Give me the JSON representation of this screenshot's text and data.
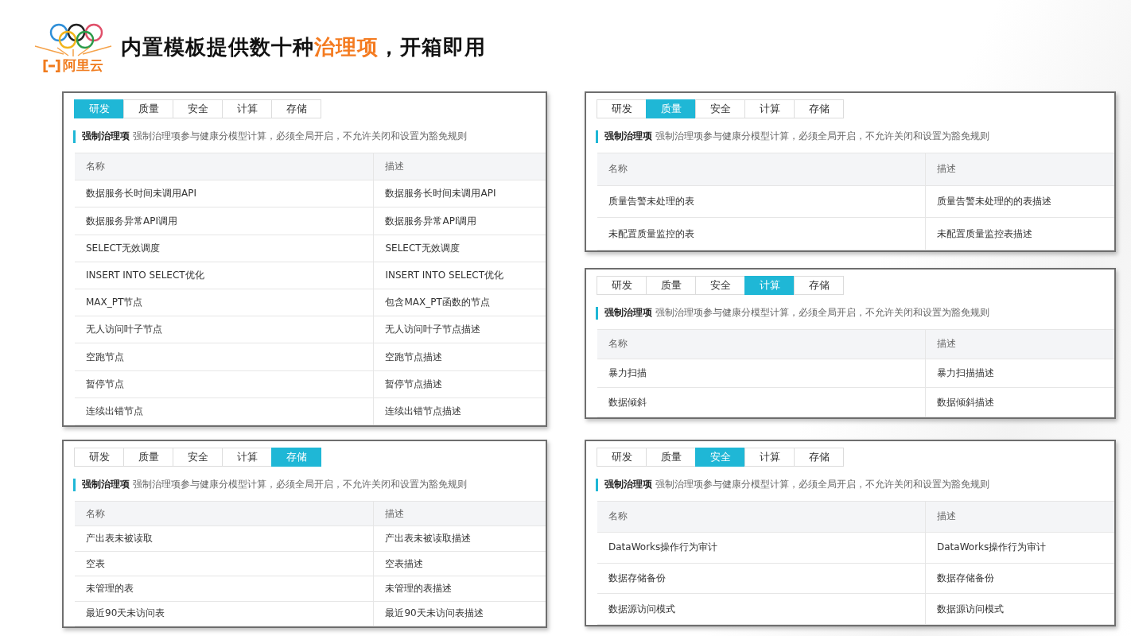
{
  "header": {
    "logo_text": "阿里云",
    "title_parts": [
      {
        "text": "内置模板提供数十种",
        "highlight": false
      },
      {
        "text": "治理项",
        "highlight": true
      },
      {
        "text": "，开箱即用",
        "highlight": false
      }
    ]
  },
  "left_column": [
    {
      "tabs": [
        {
          "label": "研发",
          "selected": true
        },
        {
          "label": "质量",
          "selected": false
        },
        {
          "label": "安全",
          "selected": false
        },
        {
          "label": "计算",
          "selected": false
        },
        {
          "label": "存储",
          "selected": false
        }
      ],
      "notice": "**强制治理项** 强制治理项参与健康分模型计算，必须全局开启，不允许关闭和设置为豁免规则",
      "columns": [
        "名称",
        "描述"
      ],
      "rows": [
        [
          "数据服务长时间未调用API",
          "数据服务长时间未调用API"
        ],
        [
          "数据服务异常API调用",
          "数据服务异常API调用"
        ],
        [
          "SELECT无效调度",
          "SELECT无效调度"
        ],
        [
          "INSERT INTO SELECT优化",
          "INSERT INTO SELECT优化"
        ],
        [
          "MAX_PT节点",
          "包含MAX_PT函数的节点"
        ],
        [
          "无人访问叶子节点",
          "无人访问叶子节点描述"
        ],
        [
          "空跑节点",
          "空跑节点描述"
        ],
        [
          "暂停节点",
          "暂停节点描述"
        ],
        [
          "连续出错节点",
          "连续出错节点描述"
        ]
      ]
    },
    {
      "tabs": [
        {
          "label": "研发",
          "selected": false
        },
        {
          "label": "质量",
          "selected": false
        },
        {
          "label": "安全",
          "selected": false
        },
        {
          "label": "计算",
          "selected": false
        },
        {
          "label": "存储",
          "selected": true
        }
      ],
      "notice": "**强制治理项** 强制治理项参与健康分模型计算，必须全局开启，不允许关闭和设置为豁免规则",
      "columns": [
        "名称",
        "描述"
      ],
      "rows": [
        [
          "产出表未被读取",
          "产出表未被读取描述"
        ],
        [
          "空表",
          "空表描述"
        ],
        [
          "未管理的表",
          "未管理的表描述"
        ],
        [
          "最近90天未访问表",
          "最近90天未访问表描述"
        ]
      ]
    }
  ],
  "right_column": [
    {
      "tabs": [
        {
          "label": "研发",
          "selected": false
        },
        {
          "label": "质量",
          "selected": true
        },
        {
          "label": "安全",
          "selected": false
        },
        {
          "label": "计算",
          "selected": false
        },
        {
          "label": "存储",
          "selected": false
        }
      ],
      "notice": "**强制治理项** 强制治理项参与健康分模型计算，必须全局开启，不允许关闭和设置为豁免规则",
      "columns": [
        "名称",
        "描述"
      ],
      "rows": [
        [
          "质量告警未处理的表",
          "质量告警未处理的的表描述"
        ],
        [
          "未配置质量监控的表",
          "未配置质量监控表描述"
        ]
      ]
    },
    {
      "tabs": [
        {
          "label": "研发",
          "selected": false
        },
        {
          "label": "质量",
          "selected": false
        },
        {
          "label": "安全",
          "selected": false
        },
        {
          "label": "计算",
          "selected": true
        },
        {
          "label": "存储",
          "selected": false
        }
      ],
      "notice": "**强制治理项** 强制治理项参与健康分模型计算，必须全局开启，不允许关闭和设置为豁免规则",
      "columns": [
        "名称",
        "描述"
      ],
      "rows": [
        [
          "暴力扫描",
          "暴力扫描描述"
        ],
        [
          "数据倾斜",
          "数据倾斜描述"
        ]
      ]
    },
    {
      "tabs": [
        {
          "label": "研发",
          "selected": false
        },
        {
          "label": "质量",
          "selected": false
        },
        {
          "label": "安全",
          "selected": true
        },
        {
          "label": "计算",
          "selected": false
        },
        {
          "label": "存储",
          "selected": false
        }
      ],
      "notice": "**强制治理项** 强制治理项参与健康分模型计算，必须全局开启，不允许关闭和设置为豁免规则",
      "columns": [
        "名称",
        "描述"
      ],
      "rows": [
        [
          "DataWorks操作行为审计",
          "DataWorks操作行为审计"
        ],
        [
          "数据存储备份",
          "数据存储备份"
        ],
        [
          "数据源访问模式",
          "数据源访问模式"
        ]
      ]
    }
  ]
}
